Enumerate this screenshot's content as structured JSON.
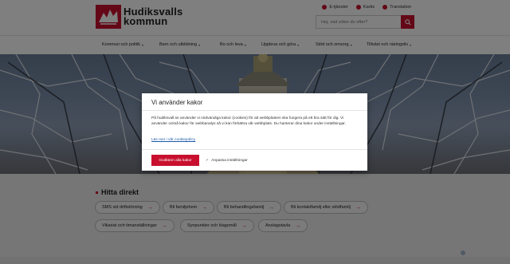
{
  "header": {
    "logo_line1": "Hudiksvalls",
    "logo_line2": "kommun",
    "utility": [
      {
        "label": "E-tjänster",
        "icon": "tablet-icon"
      },
      {
        "label": "Kartis",
        "icon": "map-pin-icon"
      },
      {
        "label": "Translation",
        "icon": "globe-icon"
      }
    ],
    "search_placeholder": "Hej, vad söker du efter?"
  },
  "nav": {
    "items": [
      "Kommun och politik",
      "Barn och utbildning",
      "Bo och leva",
      "Uppleva och göra",
      "Stöd och omsorg",
      "Tillväxt och näringsliv"
    ]
  },
  "quick": {
    "title": "Hitta direkt",
    "chips": [
      "SMS vid driftstörning",
      "Bli familjehem",
      "Bli behandlingsfamilj",
      "Bli kontaktfamilj eller stödfamilj",
      "Vikariat och timanställningar",
      "Synpunkter och klagomål",
      "Anslagstavla"
    ]
  },
  "cookie": {
    "title": "Vi använder kakor",
    "body": "På hudiksvall.se använder vi nödvändiga kakor (cookies) för att webbplatsen ska fungera på ett bra sätt för dig. Vi använder också kakor för webbanalys så vi kan förbättra vår webbplats. Du hanterar dina kakor under inställningar.",
    "link": "Läs mer i vår cookiepolicy",
    "accept": "Godkänn alla kakor",
    "customize": "Anpassa inställningar"
  },
  "colors": {
    "brand_red": "#c8102e",
    "link_blue": "#1a5aa8"
  }
}
